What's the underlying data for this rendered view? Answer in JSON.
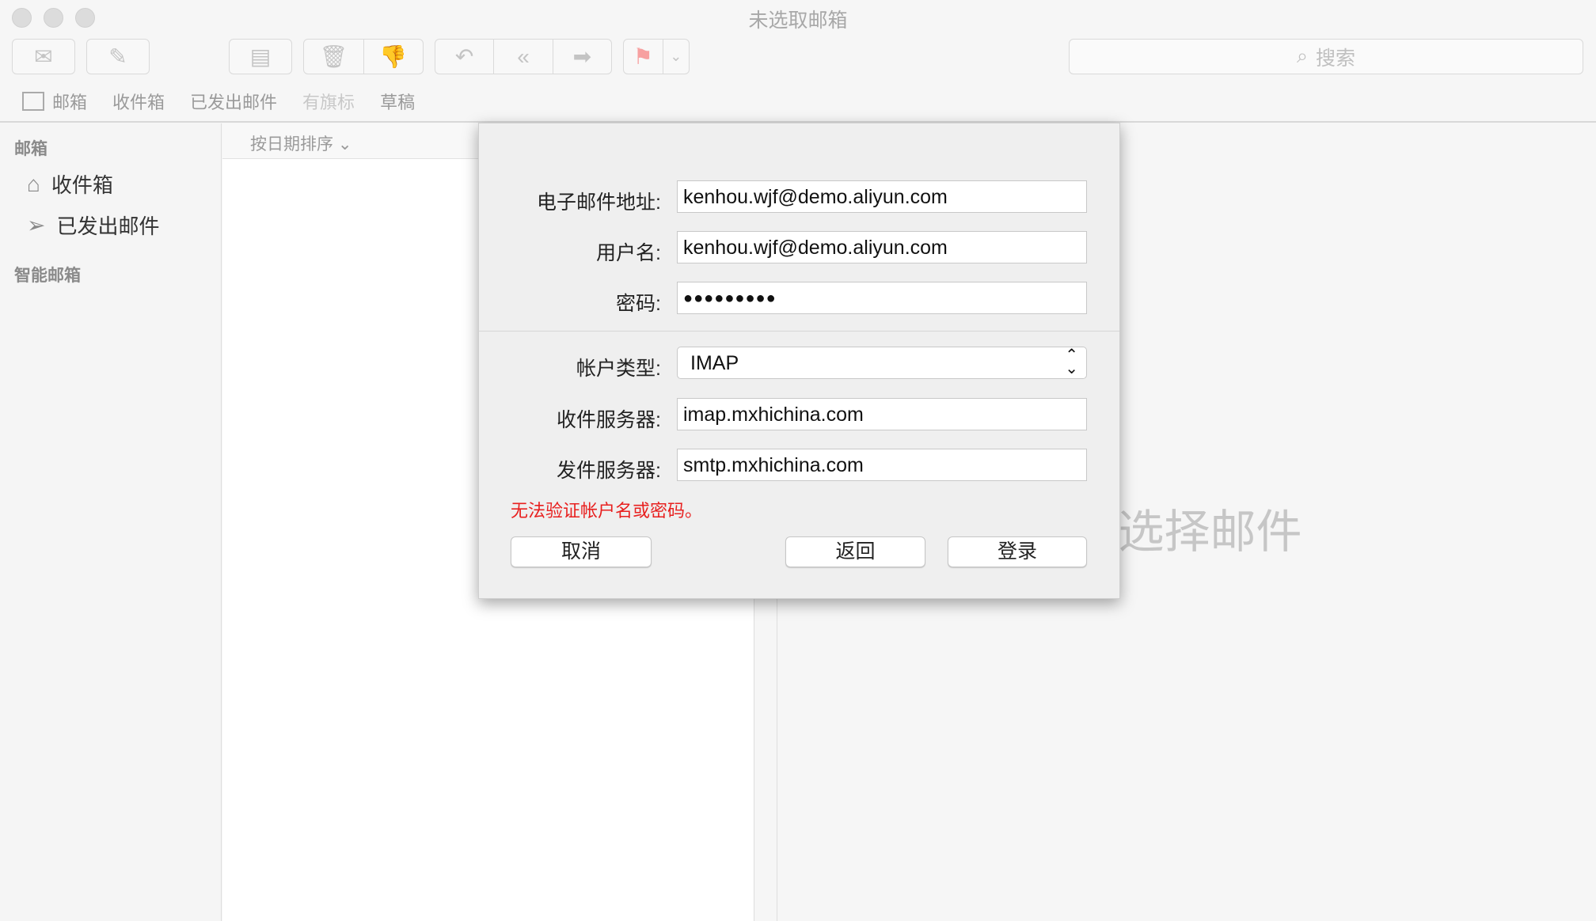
{
  "window": {
    "title": "未选取邮箱"
  },
  "toolbar": {
    "get_mail_icon": "envelope-icon",
    "compose_icon": "compose-icon",
    "archive_icon": "archive-icon",
    "delete_icon": "trash-icon",
    "junk_icon": "thumbs-down-icon",
    "reply_icon": "reply-icon",
    "reply_all_icon": "reply-all-icon",
    "forward_icon": "forward-icon",
    "flag_icon": "flag-icon",
    "flag_color": "#f7a0a0",
    "search_placeholder": "搜索"
  },
  "favorites": {
    "items": [
      {
        "label": "邮箱"
      },
      {
        "label": "收件箱"
      },
      {
        "label": "已发出邮件"
      },
      {
        "label": "有旗标"
      },
      {
        "label": "草稿"
      }
    ]
  },
  "sidebar": {
    "section_mailboxes": "邮箱",
    "items": [
      {
        "label": "收件箱"
      },
      {
        "label": "已发出邮件"
      }
    ],
    "section_smart": "智能邮箱"
  },
  "list": {
    "sort_label": "按日期排序"
  },
  "viewer": {
    "empty_text": "未选择邮件"
  },
  "dialog": {
    "email_label": "电子邮件地址:",
    "email_value": "kenhou.wjf@demo.aliyun.com",
    "username_label": "用户名:",
    "username_value": "kenhou.wjf@demo.aliyun.com",
    "password_label": "密码:",
    "password_value": "●●●●●●●●●",
    "account_type_label": "帐户类型:",
    "account_type_value": "IMAP",
    "incoming_label": "收件服务器:",
    "incoming_value": "imap.mxhichina.com",
    "outgoing_label": "发件服务器:",
    "outgoing_value": "smtp.mxhichina.com",
    "error": "无法验证帐户名或密码。",
    "error_color": "#e8201f",
    "cancel": "取消",
    "back": "返回",
    "login": "登录"
  }
}
